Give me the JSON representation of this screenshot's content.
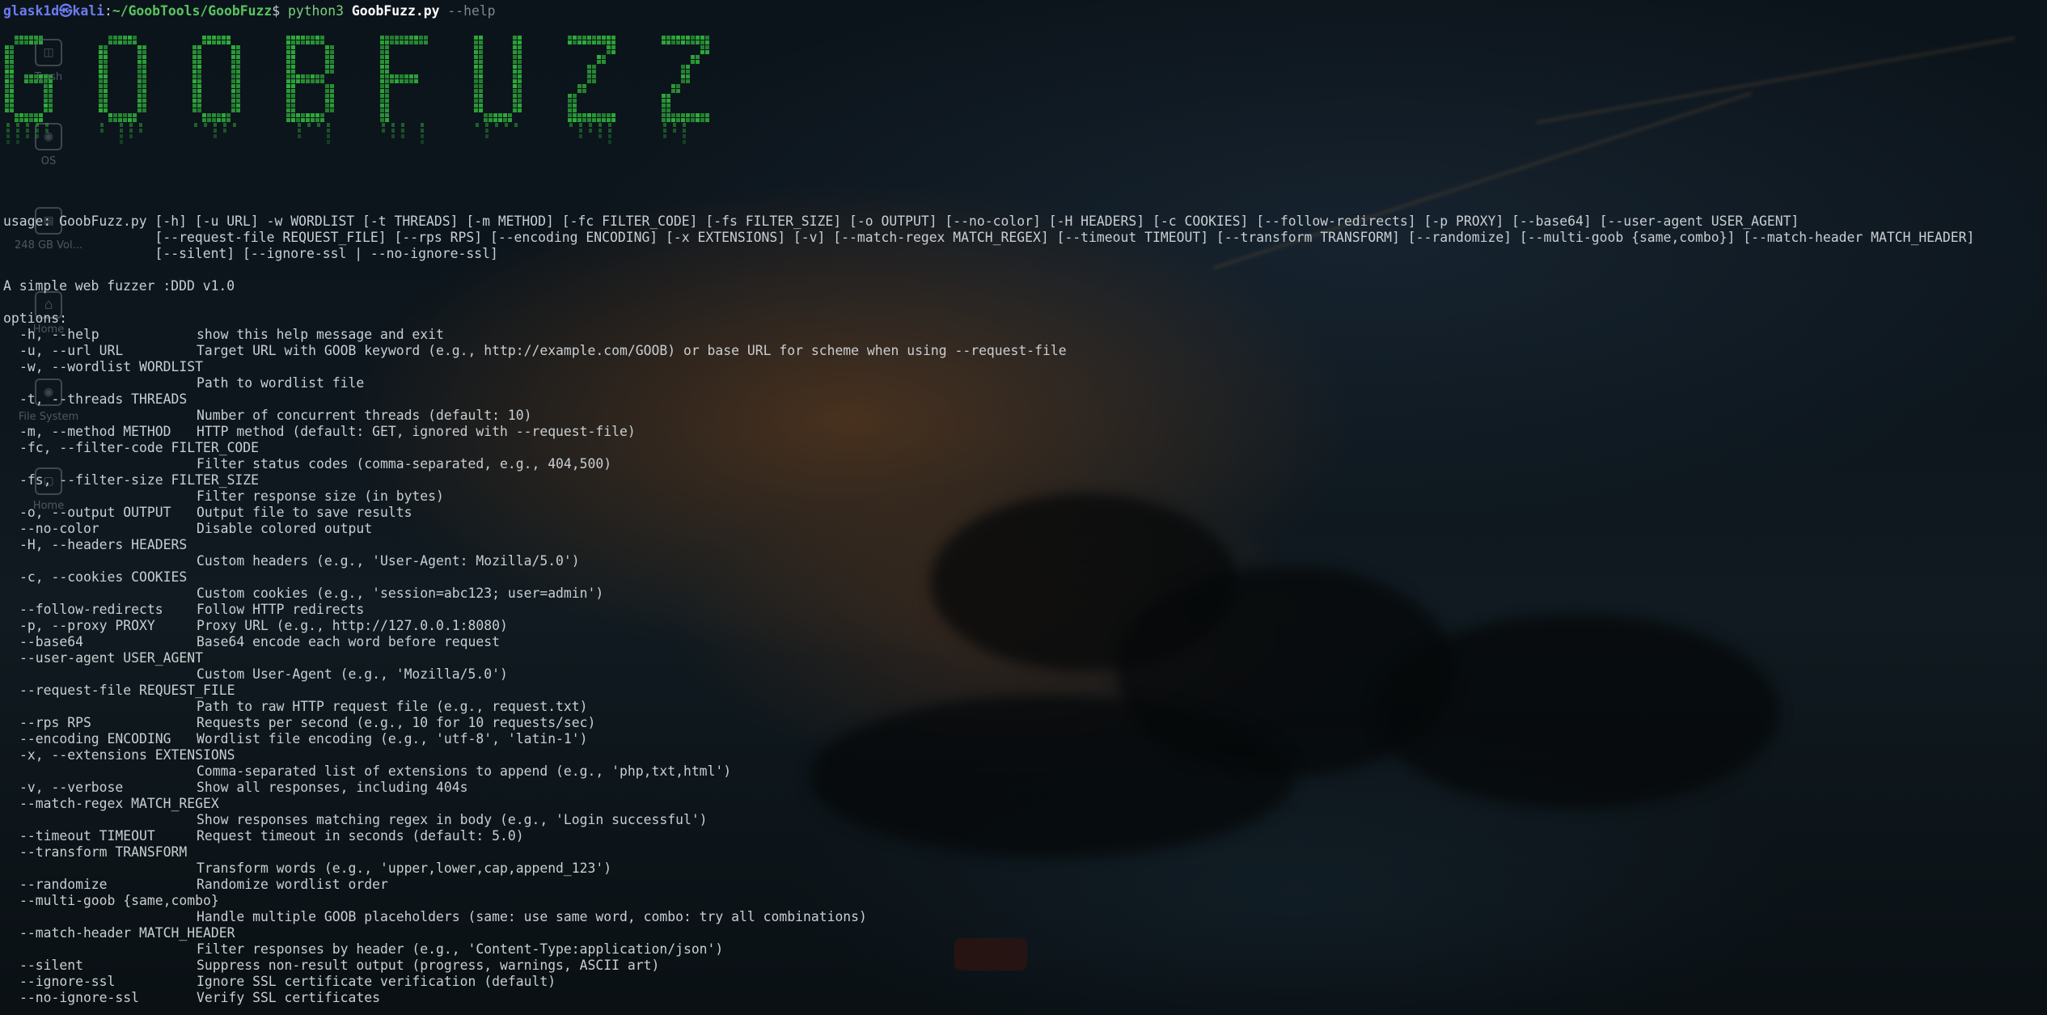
{
  "prompt": {
    "user_host": "glask1d㉿kali",
    "sep": ":",
    "path": "~/GoobTools/GoobFuzz",
    "dollar": "$",
    "cmd": "python3",
    "script": "GoobFuzz.py",
    "arg": "--help"
  },
  "banner_text": "GOOBFUZZ",
  "colors": {
    "banner_green": "#2fae3a",
    "prompt_user": "#6c7cf2",
    "prompt_path": "#59c45f",
    "text": "#c9ced2"
  },
  "desktop_icons": [
    {
      "label": "Trash",
      "icon": "trash-icon"
    },
    {
      "label": "OS",
      "icon": "disk-icon"
    },
    {
      "label": "248 GB Vol...",
      "icon": "drive-icon"
    },
    {
      "label": "Home",
      "icon": "home-icon"
    },
    {
      "label": "File System",
      "icon": "filesystem-icon"
    },
    {
      "label": "Home",
      "icon": "folder-icon"
    }
  ],
  "usage": [
    "usage: GoobFuzz.py [-h] [-u URL] -w WORDLIST [-t THREADS] [-m METHOD] [-fc FILTER_CODE] [-fs FILTER_SIZE] [-o OUTPUT] [--no-color] [-H HEADERS] [-c COOKIES] [--follow-redirects] [-p PROXY] [--base64] [--user-agent USER_AGENT]",
    "                   [--request-file REQUEST_FILE] [--rps RPS] [--encoding ENCODING] [-x EXTENSIONS] [-v] [--match-regex MATCH_REGEX] [--timeout TIMEOUT] [--transform TRANSFORM] [--randomize] [--multi-goob {same,combo}] [--match-header MATCH_HEADER]",
    "                   [--silent] [--ignore-ssl | --no-ignore-ssl]"
  ],
  "description": "A simple web fuzzer :DDD v1.0",
  "options_heading": "options:",
  "options": [
    {
      "flag": "-h, --help",
      "desc": "show this help message and exit",
      "wrap": false
    },
    {
      "flag": "-u, --url URL",
      "desc": "Target URL with GOOB keyword (e.g., http://example.com/GOOB) or base URL for scheme when using --request-file",
      "wrap": false
    },
    {
      "flag": "-w, --wordlist WORDLIST",
      "desc": "Path to wordlist file",
      "wrap": true
    },
    {
      "flag": "-t, --threads THREADS",
      "desc": "Number of concurrent threads (default: 10)",
      "wrap": true
    },
    {
      "flag": "-m, --method METHOD",
      "desc": "HTTP method (default: GET, ignored with --request-file)",
      "wrap": false
    },
    {
      "flag": "-fc, --filter-code FILTER_CODE",
      "desc": "Filter status codes (comma-separated, e.g., 404,500)",
      "wrap": true
    },
    {
      "flag": "-fs, --filter-size FILTER_SIZE",
      "desc": "Filter response size (in bytes)",
      "wrap": true
    },
    {
      "flag": "-o, --output OUTPUT",
      "desc": "Output file to save results",
      "wrap": false
    },
    {
      "flag": "--no-color",
      "desc": "Disable colored output",
      "wrap": false
    },
    {
      "flag": "-H, --headers HEADERS",
      "desc": "Custom headers (e.g., 'User-Agent: Mozilla/5.0')",
      "wrap": true
    },
    {
      "flag": "-c, --cookies COOKIES",
      "desc": "Custom cookies (e.g., 'session=abc123; user=admin')",
      "wrap": true
    },
    {
      "flag": "--follow-redirects",
      "desc": "Follow HTTP redirects",
      "wrap": false
    },
    {
      "flag": "-p, --proxy PROXY",
      "desc": "Proxy URL (e.g., http://127.0.0.1:8080)",
      "wrap": false
    },
    {
      "flag": "--base64",
      "desc": "Base64 encode each word before request",
      "wrap": false
    },
    {
      "flag": "--user-agent USER_AGENT",
      "desc": "Custom User-Agent (e.g., 'Mozilla/5.0')",
      "wrap": true
    },
    {
      "flag": "--request-file REQUEST_FILE",
      "desc": "Path to raw HTTP request file (e.g., request.txt)",
      "wrap": true
    },
    {
      "flag": "--rps RPS",
      "desc": "Requests per second (e.g., 10 for 10 requests/sec)",
      "wrap": false
    },
    {
      "flag": "--encoding ENCODING",
      "desc": "Wordlist file encoding (e.g., 'utf-8', 'latin-1')",
      "wrap": false
    },
    {
      "flag": "-x, --extensions EXTENSIONS",
      "desc": "Comma-separated list of extensions to append (e.g., 'php,txt,html')",
      "wrap": true
    },
    {
      "flag": "-v, --verbose",
      "desc": "Show all responses, including 404s",
      "wrap": false
    },
    {
      "flag": "--match-regex MATCH_REGEX",
      "desc": "Show responses matching regex in body (e.g., 'Login successful')",
      "wrap": true
    },
    {
      "flag": "--timeout TIMEOUT",
      "desc": "Request timeout in seconds (default: 5.0)",
      "wrap": false
    },
    {
      "flag": "--transform TRANSFORM",
      "desc": "Transform words (e.g., 'upper,lower,cap,append_123')",
      "wrap": true
    },
    {
      "flag": "--randomize",
      "desc": "Randomize wordlist order",
      "wrap": false
    },
    {
      "flag": "--multi-goob {same,combo}",
      "desc": "Handle multiple GOOB placeholders (same: use same word, combo: try all combinations)",
      "wrap": true
    },
    {
      "flag": "--match-header MATCH_HEADER",
      "desc": "Filter responses by header (e.g., 'Content-Type:application/json')",
      "wrap": true
    },
    {
      "flag": "--silent",
      "desc": "Suppress non-result output (progress, warnings, ASCII art)",
      "wrap": false
    },
    {
      "flag": "--ignore-ssl",
      "desc": "Ignore SSL certificate verification (default)",
      "wrap": false
    },
    {
      "flag": "--no-ignore-ssl",
      "desc": "Verify SSL certificates",
      "wrap": false
    }
  ]
}
